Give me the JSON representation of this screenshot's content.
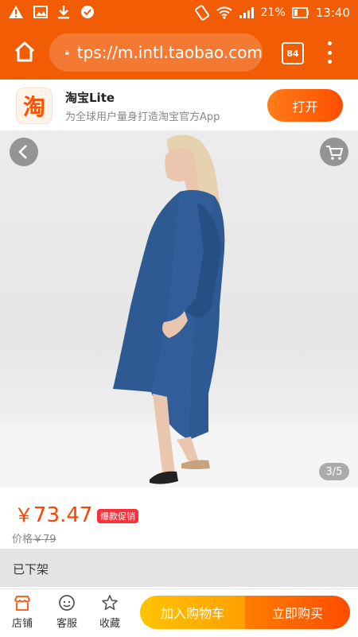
{
  "status_bar": {
    "battery": "21%",
    "time": "13:40",
    "icons": [
      "warning-icon",
      "image-icon",
      "download-icon",
      "notification-icon",
      "rotate-icon",
      "wifi-icon",
      "signal-icon",
      "battery-icon"
    ]
  },
  "browser": {
    "url": "tps://m.intl.taobao.com",
    "tab_count": "84"
  },
  "app_banner": {
    "logo_char": "淘",
    "name": "淘宝Lite",
    "desc": "为全球用户量身打造淘宝官方App",
    "open_label": "打开"
  },
  "gallery": {
    "counter": "3/5"
  },
  "product": {
    "currency": "￥",
    "price": "73.47",
    "promo_badge": "爆款促销",
    "orig_label": "价格",
    "orig_price": "￥79",
    "status": "已下架"
  },
  "bottom_bar": {
    "shop": "店铺",
    "service": "客服",
    "favorite": "收藏",
    "add_cart": "加入购物车",
    "buy_now": "立即购买"
  },
  "colors": {
    "brand_orange": "#f25c05",
    "price_red": "#ff4400",
    "cart_yellow": "#ffb300"
  }
}
